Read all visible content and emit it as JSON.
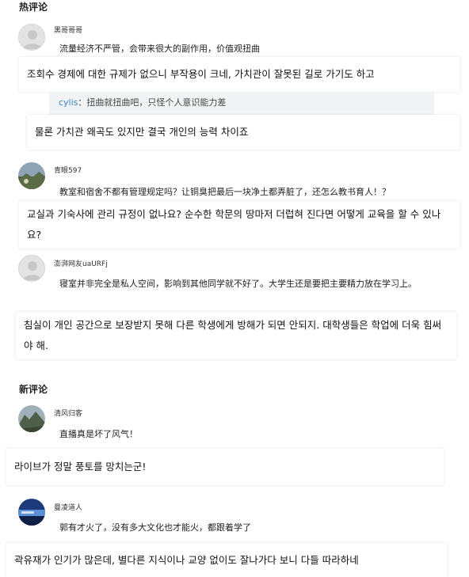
{
  "sections": {
    "hot_title": "热评论",
    "new_title": "新评论"
  },
  "comments": [
    {
      "username": "黑哥哥哥",
      "text": "流量经济不严管，会带来很大的副作用，价值观扭曲",
      "translation": "조회수 경제에 대한 규제가 없으니 부작용이 크네, 가치관이 잘못된 길로 가기도 하고",
      "reply": {
        "name": "cylis",
        "separator": "：",
        "text": "扭曲就扭曲吧，只怪个人意识能力差",
        "translation": "물론 가치관 왜곡도 있지만 결국 개인의 능력 차이죠"
      }
    },
    {
      "username": "青眼597",
      "text": "教室和宿舍不都有管理规定吗？让铜臭把最后一块净土都弄脏了，还怎么教书育人！？",
      "translation": "교실과 기숙사에 관리 규정이 없나요? 순수한 학문의 땅마저 더럽혀 진다면 어떻게 교육을 할 수 있나요?"
    },
    {
      "username": "澎湃网友uaURFj",
      "text": "寝室并非完全是私人空间，影响到其他同学就不好了。大学生还是要把主要精力放在学习上。",
      "translation": "침실이 개인 공간으로 보장받지 못해 다른 학생에게 방해가 되면 안되지. 대학생들은 학업에 더욱 힘써야 해."
    },
    {
      "username": "清风归客",
      "text": "直播真是坏了风气！",
      "translation": "라이브가 정말 풍토를 망치는군!"
    },
    {
      "username": "曼凌道人",
      "text": "郭有才火了，没有多大文化也才能火，都跟着学了",
      "translation": "곽유재가 인기가 많은데, 별다른 지식이나 교양 없이도 잘나가다 보니 다들 따라하네"
    }
  ],
  "colors": {
    "reply_name": "#3d82c4",
    "reply_bg": "#f1f3f5",
    "page_bg": "#ffffff"
  }
}
